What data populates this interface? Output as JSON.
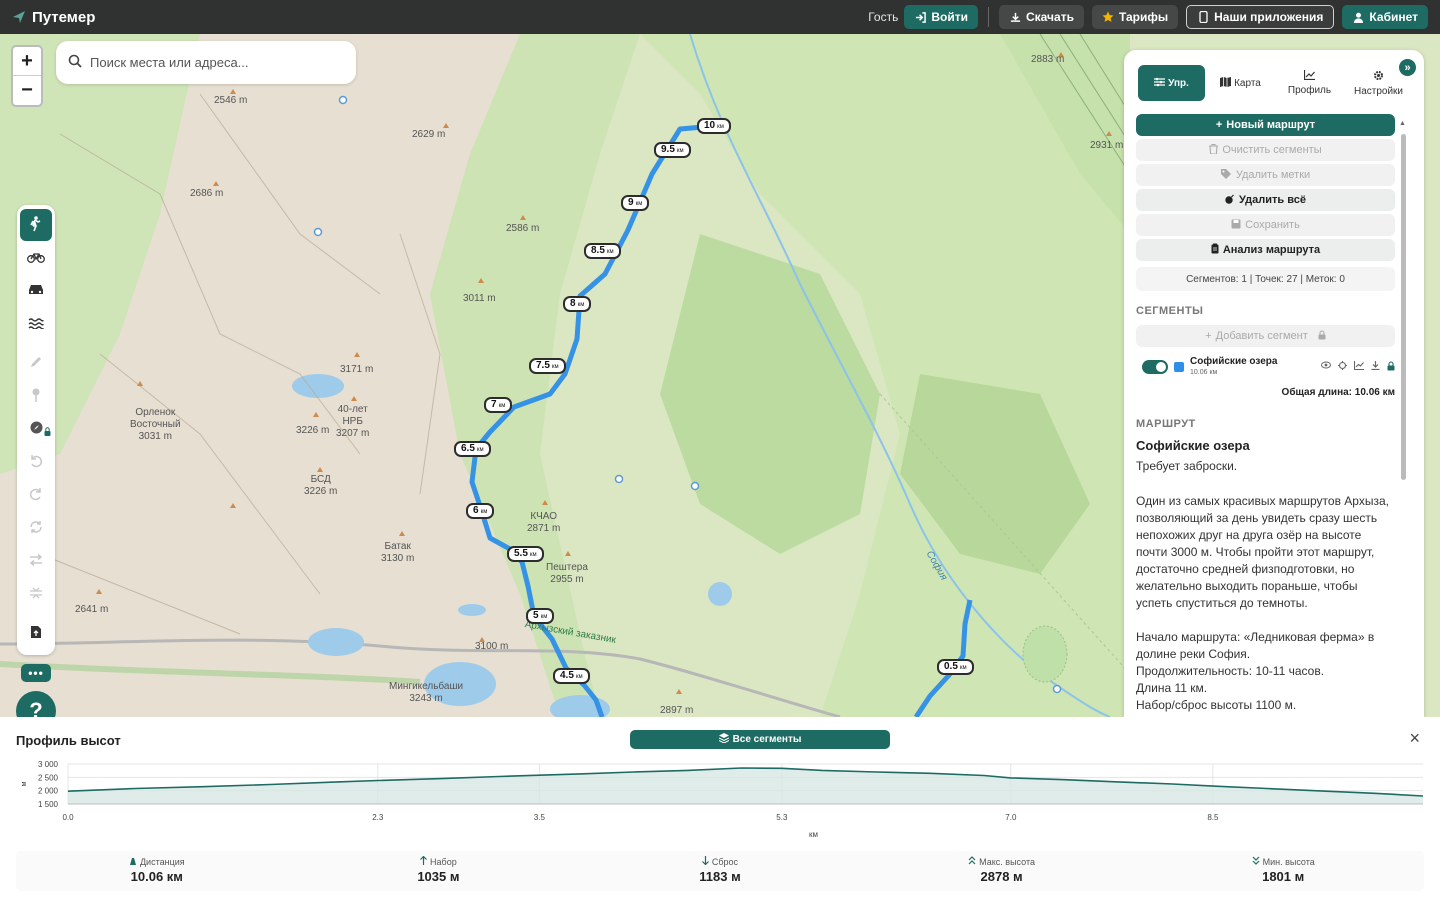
{
  "app": {
    "name": "Путемер"
  },
  "topbar": {
    "guest_label": "Гость",
    "login": "Войти",
    "download": "Скачать",
    "tariffs": "Тарифы",
    "apps": "Наши приложения",
    "cabinet": "Кабинет"
  },
  "search": {
    "placeholder": "Поиск места или адреса..."
  },
  "zoom": {
    "in": "+",
    "out": "−"
  },
  "map": {
    "labels": [
      {
        "text": "2883 m"
      },
      {
        "text": "2546 m"
      },
      {
        "text": "2629 m"
      },
      {
        "text": "2686 m"
      },
      {
        "text": "2931 m"
      },
      {
        "text": "2586 m"
      },
      {
        "text": "3011 m"
      },
      {
        "text": "3171 m"
      },
      {
        "text": "Орленок\nВосточный\n3031 m"
      },
      {
        "text": "40-лет\nНРБ\n3207 m"
      },
      {
        "text": "3226 m"
      },
      {
        "text": "БСД\n3226 m"
      },
      {
        "text": "КЧАО\n2871 m"
      },
      {
        "text": "Батак\n3130 m"
      },
      {
        "text": "Пештера\n2955 m"
      },
      {
        "text": "2641 m"
      },
      {
        "text": "Архызский заказник"
      },
      {
        "text": "3100 m"
      },
      {
        "text": "Мингикельбаши\n3243 m"
      },
      {
        "text": "2897 m"
      },
      {
        "text": "София"
      }
    ],
    "km_markers": [
      "10",
      "9.5",
      "9",
      "8.5",
      "8",
      "7.5",
      "7",
      "6.5",
      "6",
      "5.5",
      "5",
      "4.5",
      "0.5"
    ],
    "km_unit": "км",
    "route_color": "#3592e4"
  },
  "panel": {
    "tabs": [
      {
        "label": "Упр.",
        "icon": "sliders-icon"
      },
      {
        "label": "Карта",
        "icon": "map-icon"
      },
      {
        "label": "Профиль",
        "icon": "chart-icon"
      },
      {
        "label": "Настройки",
        "icon": "gear-icon"
      }
    ],
    "buttons": {
      "new_route": "Новый маршрут",
      "clear_segments": "Очистить сегменты",
      "delete_marks": "Удалить метки",
      "delete_all": "Удалить всё",
      "save": "Сохранить",
      "analysis": "Анализ маршрута"
    },
    "stats": "Сегментов: 1 | Точек: 27 | Меток: 0",
    "segments_heading": "СЕГМЕНТЫ",
    "add_segment": "Добавить сегмент",
    "segment": {
      "name": "Софийские озера",
      "length": "10.06 км",
      "color": "#2f8ee8"
    },
    "total": "Общая длина: 10.06 км",
    "route_heading": "МАРШРУТ",
    "route_title": "Софийские озера",
    "route_subtitle": "Требует заброски.",
    "desc1": "Один из самых красивых маршрутов Архыза, позволяющий за день увидеть сразу шесть непохожих друг на друга озёр на высоте почти 3000 м. Чтобы пройти этот маршрут, достаточно средней физподготовки, но желательно выходить пораньше, чтобы успеть спуститься до темноты.",
    "desc2": "Начало маршрута: «Ледниковая ферма» в долине реки София.",
    "desc3": "Продолжительность: 10-11 часов.",
    "desc4": "Длина 11 км.",
    "desc5": "Набор/сброс высоты 1100 м."
  },
  "profile": {
    "title": "Профиль высот",
    "all_segments": "Все сегменты",
    "close": "×",
    "chart_data": {
      "type": "area",
      "x": [
        0,
        0.5,
        1.0,
        1.5,
        2.0,
        2.3,
        2.8,
        3.2,
        3.5,
        3.8,
        4.2,
        4.6,
        5.0,
        5.3,
        5.6,
        6.0,
        6.4,
        6.8,
        7.0,
        7.4,
        7.8,
        8.2,
        8.5,
        8.9,
        9.3,
        9.7,
        10.06
      ],
      "y": [
        1980,
        2080,
        2150,
        2230,
        2330,
        2380,
        2460,
        2530,
        2580,
        2630,
        2700,
        2760,
        2850,
        2840,
        2760,
        2700,
        2650,
        2570,
        2480,
        2410,
        2330,
        2250,
        2170,
        2080,
        1990,
        1900,
        1801
      ],
      "xlabel": "км",
      "ylabel": "м",
      "xticks": [
        "0.0",
        "2.3",
        "3.5",
        "5.3",
        "7.0",
        "8.5"
      ],
      "yticks": [
        "3 000",
        "2 500",
        "2 000",
        "1 500"
      ],
      "ylim": [
        1500,
        3000
      ],
      "xlim": [
        0,
        10.06
      ],
      "grid": true,
      "color": "#1e6b63"
    },
    "stats": [
      {
        "label": "Дистанция",
        "value": "10.06 км",
        "icon": "hiker-icon"
      },
      {
        "label": "Набор",
        "value": "1035 м",
        "icon": "arrow-up-icon"
      },
      {
        "label": "Сброс",
        "value": "1183 м",
        "icon": "arrow-down-icon"
      },
      {
        "label": "Макс. высота",
        "value": "2878 м",
        "icon": "double-up-icon"
      },
      {
        "label": "Мин. высота",
        "value": "1801 м",
        "icon": "double-down-icon"
      }
    ]
  },
  "help": "?",
  "more": "•••"
}
